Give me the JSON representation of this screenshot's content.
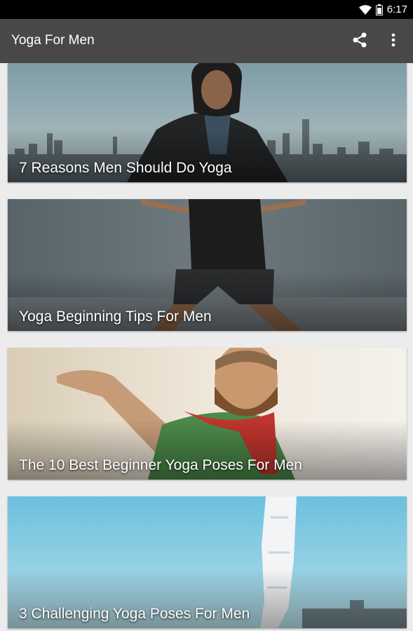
{
  "status_bar": {
    "time": "6:17",
    "icons": [
      "wifi-icon",
      "battery-icon"
    ]
  },
  "app_bar": {
    "title": "Yoga For Men",
    "actions": [
      "share-icon",
      "overflow-menu-icon"
    ]
  },
  "articles": [
    {
      "title": "7 Reasons Men Should Do Yoga",
      "image": "man-in-hoodie-city-skyline"
    },
    {
      "title": "Yoga Beginning Tips For Men",
      "image": "warrior-pose-concrete-wall"
    },
    {
      "title": "The 10 Best Beginner Yoga Poses For Men",
      "image": "bearded-man-arm-extended"
    },
    {
      "title": "3 Challenging Yoga Poses For Men",
      "image": "headstand-blue-sky"
    }
  ],
  "colors": {
    "status_bar": "#000000",
    "app_bar": "#484848",
    "background": "#ececec",
    "title_text": "#ffffff"
  }
}
